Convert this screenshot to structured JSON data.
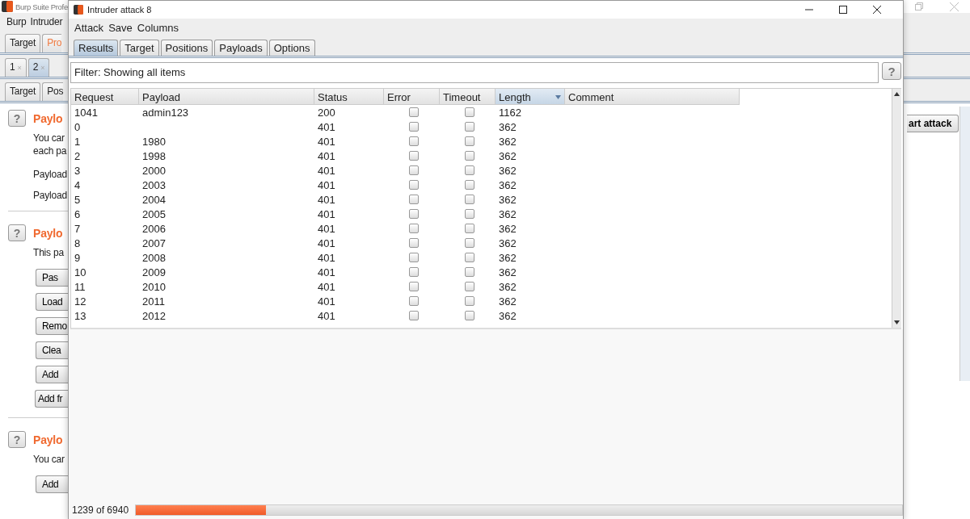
{
  "background_window": {
    "title": "Burp Suite Profe",
    "menu": [
      "Burp",
      "Intruder"
    ],
    "tool_tabs": [
      {
        "label": "Target",
        "highlighted": false
      },
      {
        "label": "Pro",
        "highlighted": true
      }
    ],
    "request_tabs": [
      {
        "label": "1",
        "close": "×",
        "selected": false
      },
      {
        "label": "2",
        "close": "×",
        "selected": true
      }
    ],
    "sub_tabs": [
      "Target",
      "Pos"
    ],
    "sections": [
      {
        "help": "?",
        "title": "Paylo",
        "text": [
          "You car",
          "each pa"
        ],
        "fields": [
          "Payload",
          "Payload"
        ]
      },
      {
        "help": "?",
        "title": "Paylo",
        "text": [
          "This pa"
        ],
        "buttons": [
          "Pas",
          "Load",
          "Remo",
          "Clea",
          "Add",
          "Add fr"
        ]
      },
      {
        "help": "?",
        "title": "Paylo",
        "text": [
          "You car"
        ],
        "buttons": [
          "Add"
        ]
      }
    ],
    "start_button": "art attack"
  },
  "attack_window": {
    "title": "Intruder attack 8",
    "menu": [
      "Attack",
      "Save",
      "Columns"
    ],
    "tabs": [
      {
        "label": "Results",
        "selected": true
      },
      {
        "label": "Target",
        "selected": false
      },
      {
        "label": "Positions",
        "selected": false
      },
      {
        "label": "Payloads",
        "selected": false
      },
      {
        "label": "Options",
        "selected": false
      }
    ],
    "filter": "Filter: Showing all items",
    "help": "?",
    "table": {
      "columns": [
        {
          "label": "Request",
          "sorted": false
        },
        {
          "label": "Payload",
          "sorted": false
        },
        {
          "label": "Status",
          "sorted": false
        },
        {
          "label": "Error",
          "sorted": false
        },
        {
          "label": "Timeout",
          "sorted": false
        },
        {
          "label": "Length",
          "sorted": true
        },
        {
          "label": "Comment",
          "sorted": false
        }
      ],
      "rows": [
        {
          "request": "1041",
          "payload": "admin123",
          "status": "200",
          "error": false,
          "timeout": false,
          "length": "1162"
        },
        {
          "request": "0",
          "status": "401",
          "error": false,
          "timeout": false,
          "length": "362"
        },
        {
          "request": "1",
          "payload": "1980",
          "status": "401",
          "error": false,
          "timeout": false,
          "length": "362"
        },
        {
          "request": "2",
          "payload": "1998",
          "status": "401",
          "error": false,
          "timeout": false,
          "length": "362"
        },
        {
          "request": "3",
          "payload": "2000",
          "status": "401",
          "error": false,
          "timeout": false,
          "length": "362"
        },
        {
          "request": "4",
          "payload": "2003",
          "status": "401",
          "error": false,
          "timeout": false,
          "length": "362"
        },
        {
          "request": "5",
          "payload": "2004",
          "status": "401",
          "error": false,
          "timeout": false,
          "length": "362"
        },
        {
          "request": "6",
          "payload": "2005",
          "status": "401",
          "error": false,
          "timeout": false,
          "length": "362"
        },
        {
          "request": "7",
          "payload": "2006",
          "status": "401",
          "error": false,
          "timeout": false,
          "length": "362"
        },
        {
          "request": "8",
          "payload": "2007",
          "status": "401",
          "error": false,
          "timeout": false,
          "length": "362"
        },
        {
          "request": "9",
          "payload": "2008",
          "status": "401",
          "error": false,
          "timeout": false,
          "length": "362"
        },
        {
          "request": "10",
          "payload": "2009",
          "status": "401",
          "error": false,
          "timeout": false,
          "length": "362"
        },
        {
          "request": "11",
          "payload": "2010",
          "status": "401",
          "error": false,
          "timeout": false,
          "length": "362"
        },
        {
          "request": "12",
          "payload": "2011",
          "status": "401",
          "error": false,
          "timeout": false,
          "length": "362"
        },
        {
          "request": "13",
          "payload": "2012",
          "status": "401",
          "error": false,
          "timeout": false,
          "length": "362"
        }
      ]
    },
    "progress": {
      "text": "1239 of 6940",
      "level": 0.17
    }
  }
}
